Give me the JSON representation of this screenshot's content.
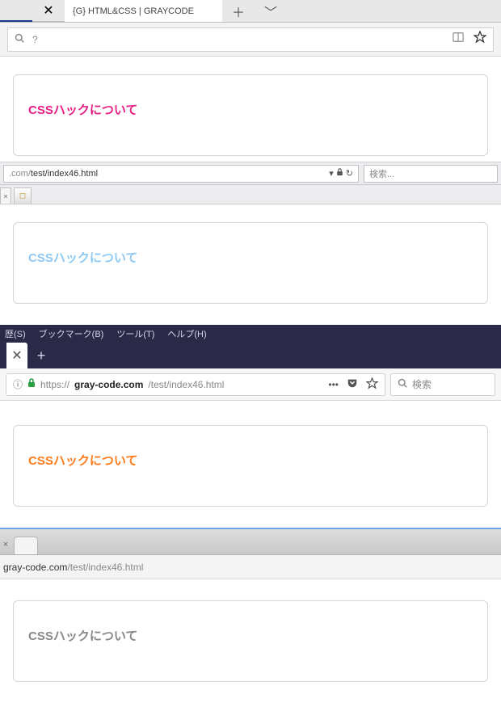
{
  "browser1": {
    "tab_title": "{G}  HTML&CSS | GRAYCODE",
    "url_placeholder": "?",
    "heading": "CSSハックについて"
  },
  "browser2": {
    "url_prefix": ".com/",
    "url_path": "test/index46.html",
    "search_placeholder": "検索...",
    "heading": "CSSハックについて"
  },
  "browser3": {
    "menu": {
      "history": "歴(S)",
      "bookmark": "ブックマーク(B)",
      "tools": "ツール(T)",
      "help": "ヘルプ(H)"
    },
    "url_proto": "https://",
    "url_host": "gray-code.com",
    "url_path": "/test/index46.html",
    "search_placeholder": "検索",
    "heading": "CSSハックについて"
  },
  "browser4": {
    "url_host": "gray-code.com",
    "url_path": "/test/index46.html",
    "heading": "CSSハックについて"
  }
}
